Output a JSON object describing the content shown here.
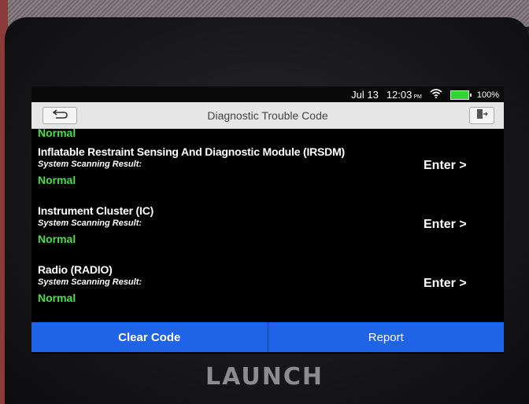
{
  "status_bar": {
    "date": "Jul 13",
    "time": "12:03",
    "ampm": "PM",
    "battery": "100%"
  },
  "header": {
    "title": "Diagnostic Trouble Code"
  },
  "list": {
    "partial_top_status": "Normal",
    "items": [
      {
        "name": "Inflatable Restraint Sensing And Diagnostic Module (IRSDM)",
        "sub": "System Scanning Result:",
        "status": "Normal",
        "action": "Enter >"
      },
      {
        "name": "Instrument Cluster (IC)",
        "sub": "System Scanning Result:",
        "status": "Normal",
        "action": "Enter >"
      },
      {
        "name": "Radio (RADIO)",
        "sub": "System Scanning Result:",
        "status": "Normal",
        "action": "Enter >"
      }
    ]
  },
  "footer": {
    "clear_label": "Clear Code",
    "report_label": "Report"
  },
  "device": {
    "brand": "LAUNCH"
  },
  "icons": {
    "back": "back-arrow-icon",
    "exit": "exit-icon",
    "wifi": "wifi-icon",
    "battery": "battery-icon"
  },
  "colors": {
    "accent": "#1f63e6",
    "status_ok": "#47e047"
  }
}
